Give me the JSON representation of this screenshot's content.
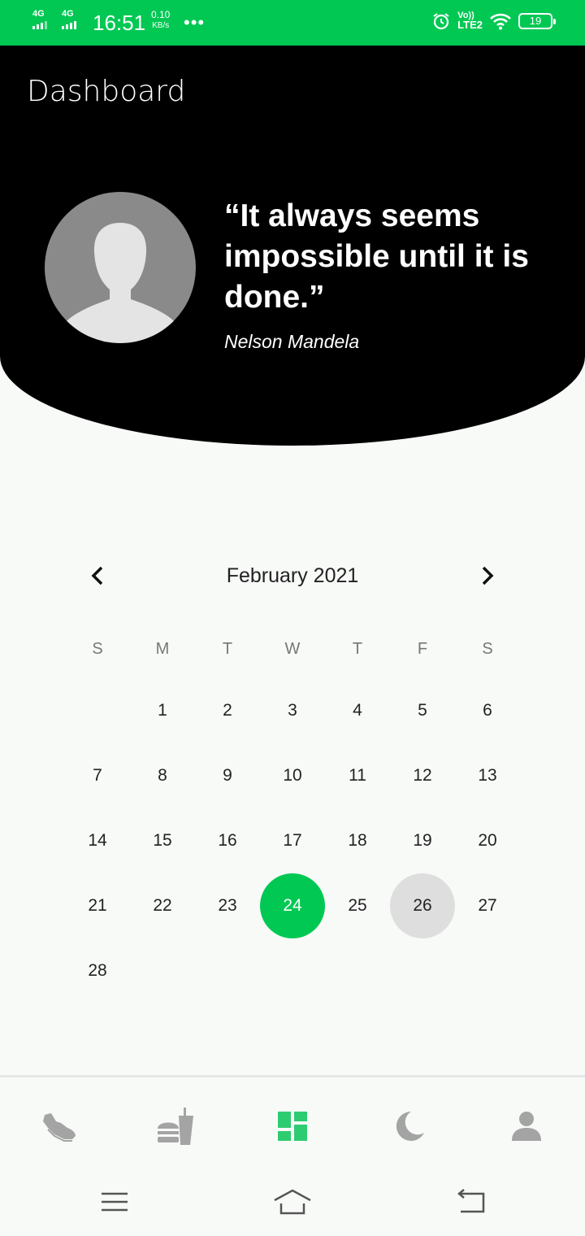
{
  "status_bar": {
    "network1": "4G",
    "network2": "4G",
    "time": "16:51",
    "speed_value": "0.10",
    "speed_unit": "KB/s",
    "dots": "•••",
    "volte": "Vo))",
    "lte": "LTE2",
    "battery": "19",
    "icons": [
      "alarm-icon",
      "wifi-icon",
      "battery-icon"
    ]
  },
  "header": {
    "title": "Dashboard"
  },
  "quote": {
    "text": "“It always seems impossible until it is done.”",
    "author": "Nelson Mandela"
  },
  "calendar": {
    "month_label": "February 2021",
    "weekdays": [
      "S",
      "M",
      "T",
      "W",
      "T",
      "F",
      "S"
    ],
    "days": [
      {
        "label": "1"
      },
      {
        "label": "2"
      },
      {
        "label": "3"
      },
      {
        "label": "4"
      },
      {
        "label": "5"
      },
      {
        "label": "6"
      },
      {
        "label": "7"
      },
      {
        "label": "8"
      },
      {
        "label": "9"
      },
      {
        "label": "10"
      },
      {
        "label": "11"
      },
      {
        "label": "12"
      },
      {
        "label": "13"
      },
      {
        "label": "14"
      },
      {
        "label": "15"
      },
      {
        "label": "16"
      },
      {
        "label": "17"
      },
      {
        "label": "18"
      },
      {
        "label": "19"
      },
      {
        "label": "20"
      },
      {
        "label": "21"
      },
      {
        "label": "22"
      },
      {
        "label": "23"
      },
      {
        "label": "24"
      },
      {
        "label": "25"
      },
      {
        "label": "26"
      },
      {
        "label": "27"
      },
      {
        "label": "28"
      }
    ],
    "first_weekday_index": 1,
    "selected_day": "24",
    "highlighted_day": "26"
  },
  "bottom_nav": {
    "items": [
      {
        "icon": "shoe-icon",
        "active": false
      },
      {
        "icon": "food-icon",
        "active": false
      },
      {
        "icon": "dashboard-icon",
        "active": true
      },
      {
        "icon": "moon-icon",
        "active": false
      },
      {
        "icon": "person-icon",
        "active": false
      }
    ]
  },
  "system_nav": {
    "icons": [
      "menu-icon",
      "home-icon",
      "back-icon"
    ]
  },
  "colors": {
    "accent": "#00c853",
    "hero_background": "#000000",
    "page_background": "#f8faf8",
    "inactive_icon": "#9e9e9e",
    "pressed_day": "#dedede"
  }
}
